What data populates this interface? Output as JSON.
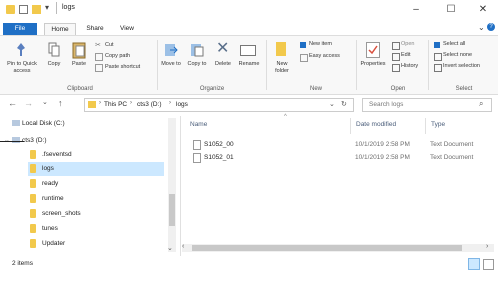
{
  "window": {
    "title": "logs"
  },
  "controls": {
    "minimize": "–",
    "maximize": "☐",
    "close": "✕"
  },
  "tabs": [
    "File",
    "Home",
    "Share",
    "View"
  ],
  "ribbon": {
    "clipboard": {
      "pin": "Pin to Quick access",
      "copy": "Copy",
      "paste": "Paste",
      "cut": "Cut",
      "copy_path": "Copy path",
      "paste_shortcut": "Paste shortcut",
      "label": "Clipboard"
    },
    "organize": {
      "move_to": "Move to",
      "copy_to": "Copy to",
      "delete": "Delete",
      "rename": "Rename",
      "label": "Organize"
    },
    "new": {
      "new_folder": "New folder",
      "new_item": "New item",
      "easy_access": "Easy access",
      "label": "New"
    },
    "open": {
      "properties": "Properties",
      "open": "Open",
      "edit": "Edit",
      "history": "History",
      "label": "Open"
    },
    "select": {
      "select_all": "Select all",
      "select_none": "Select none",
      "invert_selection": "Invert selection",
      "label": "Select"
    }
  },
  "address": {
    "crumbs": [
      "This PC",
      "cts3 (D:)",
      "logs"
    ],
    "search_placeholder": "Search logs"
  },
  "nav": {
    "local_disk": "Local Disk (C:)",
    "drive": "cts3 (D:)",
    "folders": [
      ".fseventsd",
      "logs",
      "ready",
      "runtime",
      "screen_shots",
      "tunes",
      "Updater"
    ]
  },
  "columns": {
    "name": "Name",
    "date": "Date modified",
    "type": "Type"
  },
  "files": [
    {
      "name": "S1052_00",
      "date": "10/1/2019 2:58 PM",
      "type": "Text Document"
    },
    {
      "name": "S1052_01",
      "date": "10/1/2019 2:58 PM",
      "type": "Text Document"
    }
  ],
  "status": {
    "count": "2 items"
  },
  "colors": {
    "accent": "#1f6fc5",
    "selected": "#cce8ff"
  }
}
